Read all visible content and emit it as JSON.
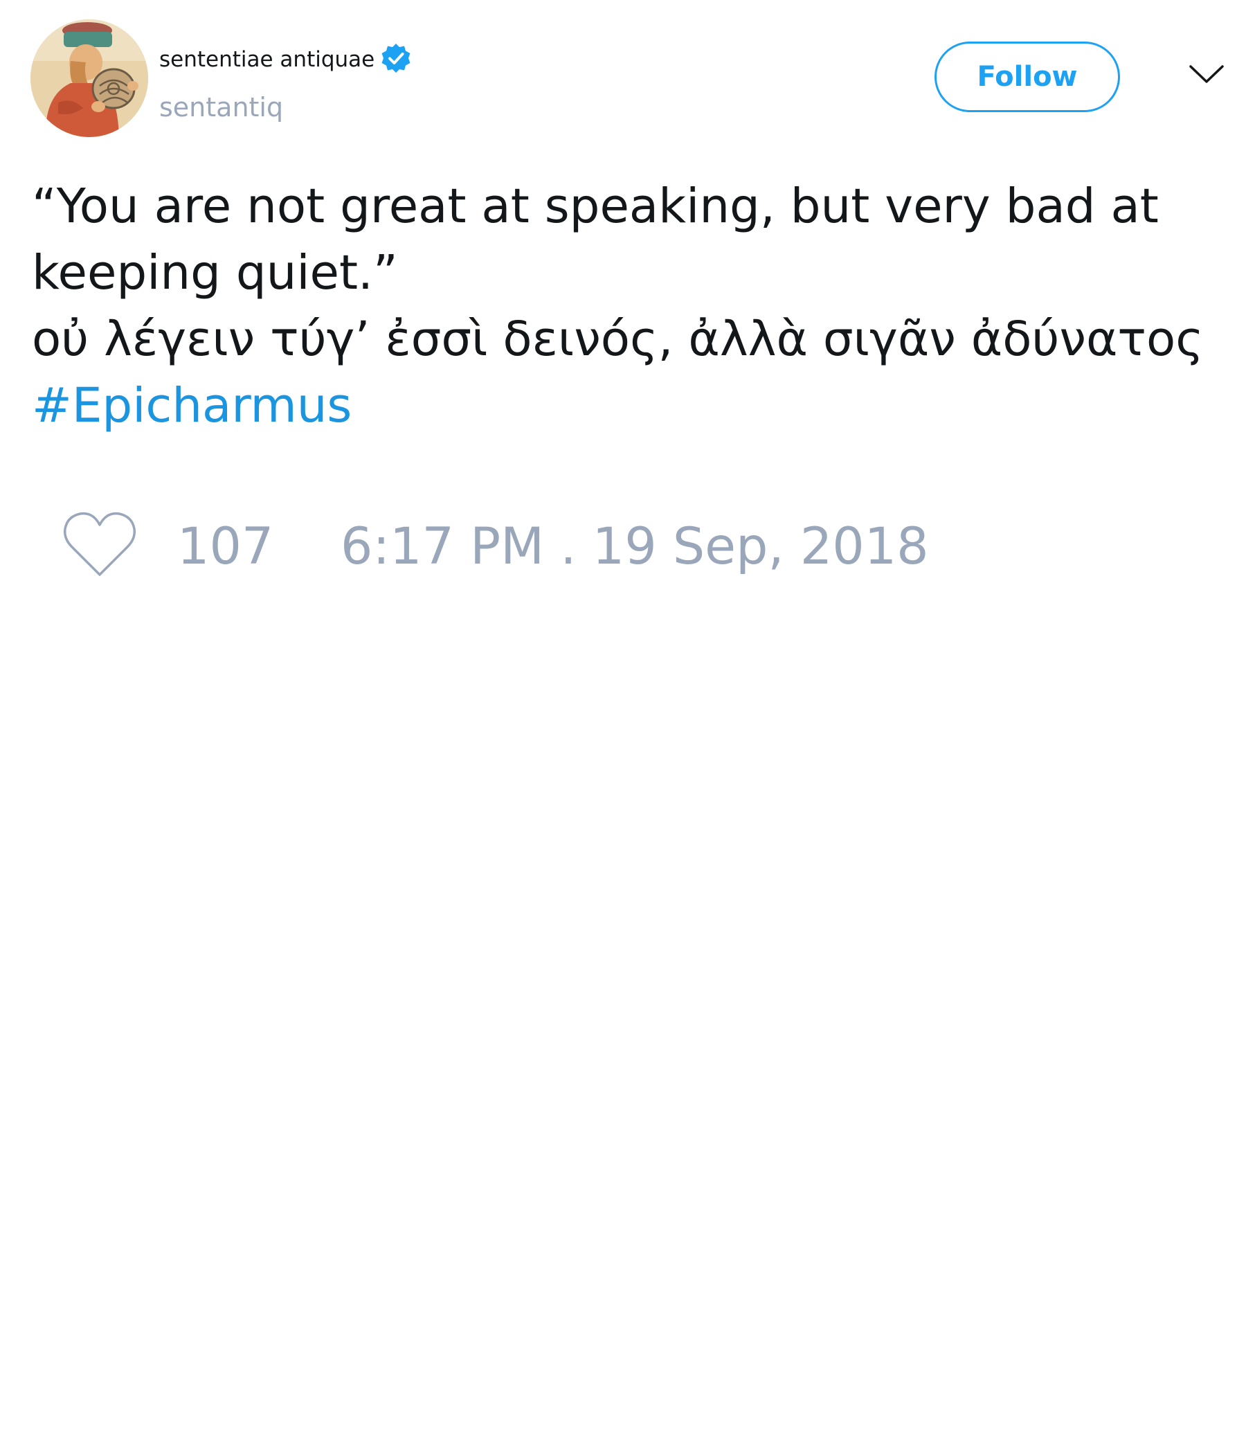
{
  "author": {
    "display_name": "sententiae antiquae",
    "handle": "sentantiq",
    "verified": true,
    "avatar": "medieval-illustration-avatar"
  },
  "header": {
    "follow_label": "Follow",
    "menu_icon": "chevron-down-icon"
  },
  "tweet": {
    "text_lines": [
      "“You are not great at speaking, but very bad at keeping quiet.”",
      "οὐ λέγειν τύγ’ ἐσσὶ δεινός, ἀλλὰ σιγᾶν ἀδύνατος"
    ],
    "hashtag": "#Epicharmus"
  },
  "footer": {
    "like_icon": "heart-icon",
    "like_count": "107",
    "timestamp": "6:17 PM . 19 Sep, 2018"
  },
  "colors": {
    "accent": "#1da1f2",
    "hashtag": "#1b95e0",
    "muted": "#9aa7ba",
    "text": "#14171a"
  }
}
